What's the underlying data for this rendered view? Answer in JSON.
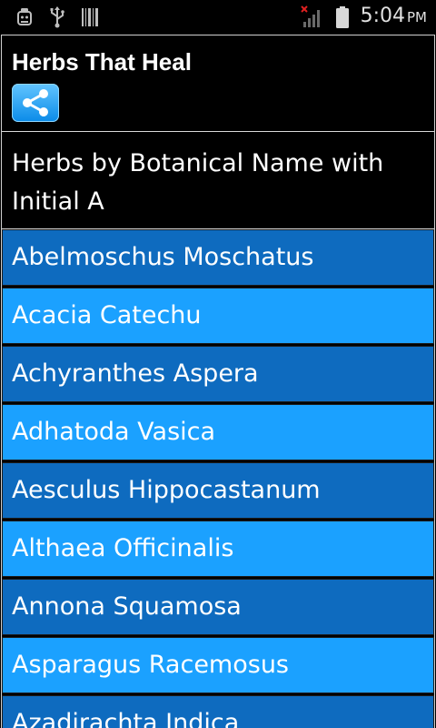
{
  "status_bar": {
    "time": "5:04",
    "ampm": "PM",
    "icons": [
      "android-debug-icon",
      "usb-icon",
      "barcode-icon",
      "no-signal-icon",
      "battery-icon"
    ]
  },
  "app": {
    "title": "Herbs That Heal",
    "share_icon": "share-icon",
    "accent_colors": {
      "item_dark": "#0e6bbf",
      "item_light": "#1ba1ff",
      "share_button": "#1a96f0"
    }
  },
  "section": {
    "heading": "Herbs by Botanical Name with Initial A"
  },
  "herbs": [
    {
      "name": "Abelmoschus Moschatus"
    },
    {
      "name": "Acacia Catechu"
    },
    {
      "name": "Achyranthes Aspera"
    },
    {
      "name": "Adhatoda Vasica"
    },
    {
      "name": "Aesculus Hippocastanum"
    },
    {
      "name": "Althaea Officinalis"
    },
    {
      "name": "Annona Squamosa"
    },
    {
      "name": "Asparagus Racemosus"
    },
    {
      "name": "Azadirachta Indica"
    }
  ]
}
